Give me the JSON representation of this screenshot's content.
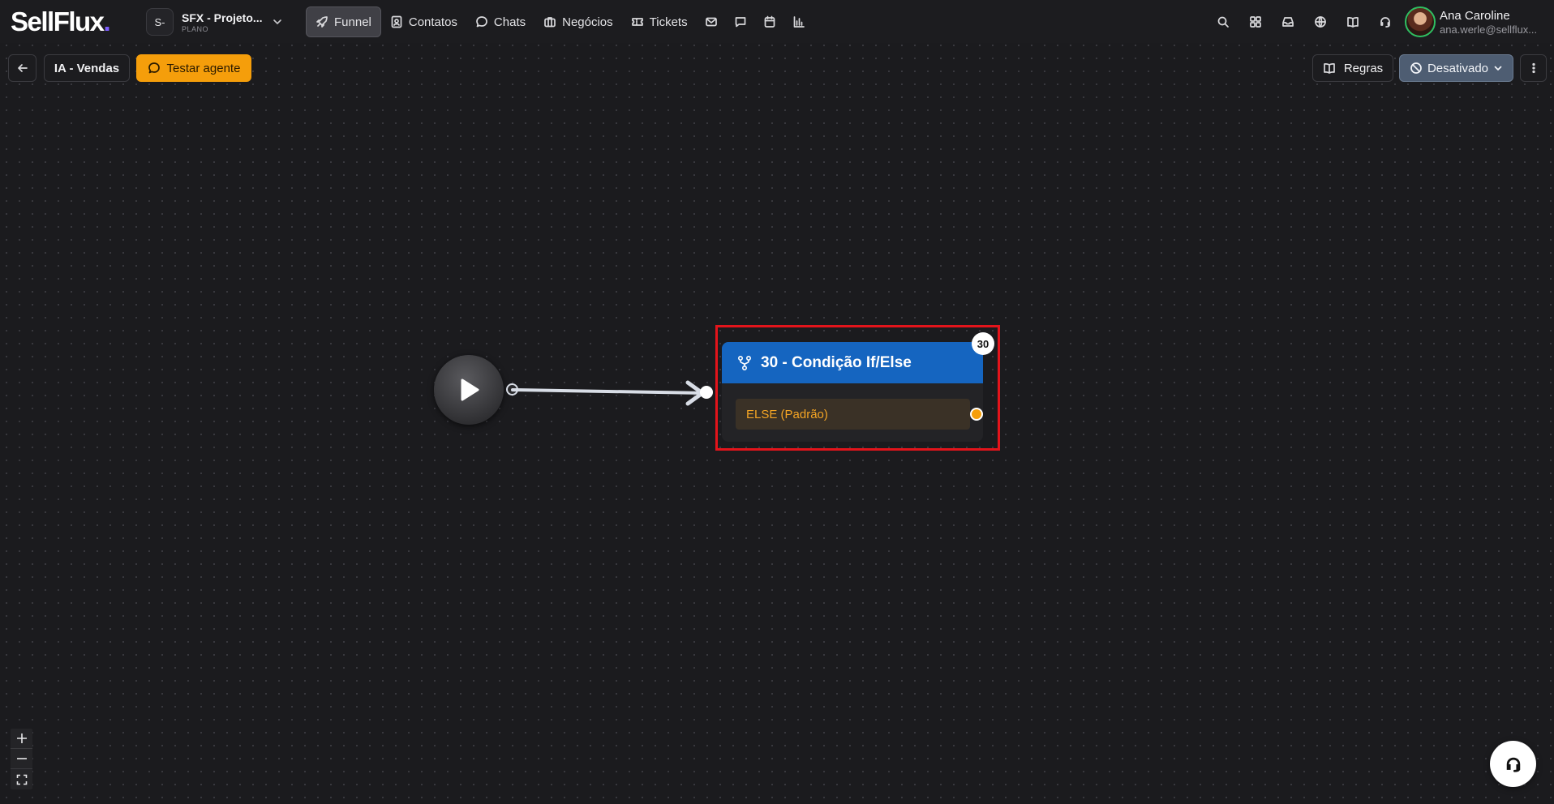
{
  "app": {
    "logo_text": "SellFlux",
    "logo_dot": "."
  },
  "workspace": {
    "badge": "S-",
    "name": "SFX - Projeto...",
    "plan": "PLANO"
  },
  "nav": {
    "items": [
      {
        "label": "Funnel",
        "icon": "rocket-icon",
        "active": true
      },
      {
        "label": "Contatos",
        "icon": "contact-card-icon"
      },
      {
        "label": "Chats",
        "icon": "chat-bubble-icon"
      },
      {
        "label": "Negócios",
        "icon": "briefcase-icon"
      },
      {
        "label": "Tickets",
        "icon": "ticket-icon"
      }
    ],
    "icon_only": [
      "mail-icon",
      "message-square-icon",
      "calendar-icon",
      "bar-chart-icon"
    ]
  },
  "header_right": {
    "icons": [
      "search-icon",
      "apps-grid-icon",
      "inbox-icon",
      "globe-icon",
      "book-icon",
      "headset-icon"
    ]
  },
  "user": {
    "name": "Ana Caroline",
    "email": "ana.werle@sellflux..."
  },
  "toolbar": {
    "flow_name": "IA - Vendas",
    "test_label": "Testar agente",
    "rules_label": "Regras",
    "status_label": "Desativado"
  },
  "canvas": {
    "node": {
      "badge": "30",
      "title": "30 - Condição If/Else",
      "else_label": "ELSE (Padrão)"
    }
  },
  "colors": {
    "accent_orange": "#f59e0b",
    "node_header_blue": "#1565c0",
    "highlight_red": "#e3141b",
    "status_slate": "#4e5d72"
  }
}
